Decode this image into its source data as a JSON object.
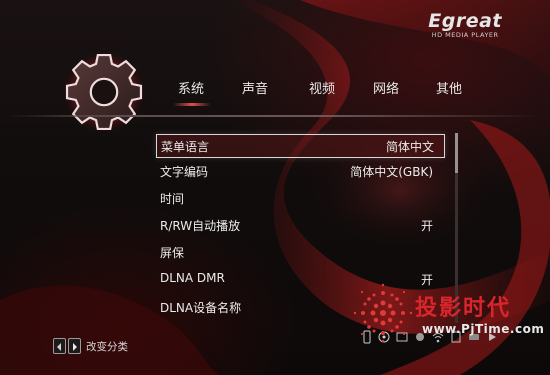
{
  "brand": {
    "name": "Egreat",
    "subtitle": "HD MEDIA PLAYER"
  },
  "tabs": [
    {
      "label": "系统",
      "active": true
    },
    {
      "label": "声音",
      "active": false
    },
    {
      "label": "视频",
      "active": false
    },
    {
      "label": "网络",
      "active": false
    },
    {
      "label": "其他",
      "active": false
    }
  ],
  "settings": [
    {
      "label": "菜单语言",
      "value": "简体中文",
      "selected": true
    },
    {
      "label": "文字编码",
      "value": "简体中文(GBK)",
      "selected": false
    },
    {
      "label": "时间",
      "value": "",
      "selected": false
    },
    {
      "label": "R/RW自动播放",
      "value": "开",
      "selected": false
    },
    {
      "label": "屏保",
      "value": "",
      "selected": false
    },
    {
      "label": "DLNA DMR",
      "value": "开",
      "selected": false
    },
    {
      "label": "DLNA设备名称",
      "value": "",
      "selected": false
    }
  ],
  "footer": {
    "hint": "改变分类",
    "left_key_icon": "left-arrow-key-icon",
    "right_key_icon": "right-arrow-key-icon"
  },
  "status_icons": [
    "usb-icon",
    "disc-icon",
    "network-icon",
    "audio-icon",
    "wifi-icon",
    "card-icon",
    "hdd-icon",
    "media-icon"
  ],
  "watermark": {
    "title": "投影时代",
    "url": "www.PjTime.com"
  },
  "colors": {
    "accent": "#d8262c",
    "highlight_border": "#d8d8d8",
    "text": "#ececec"
  }
}
